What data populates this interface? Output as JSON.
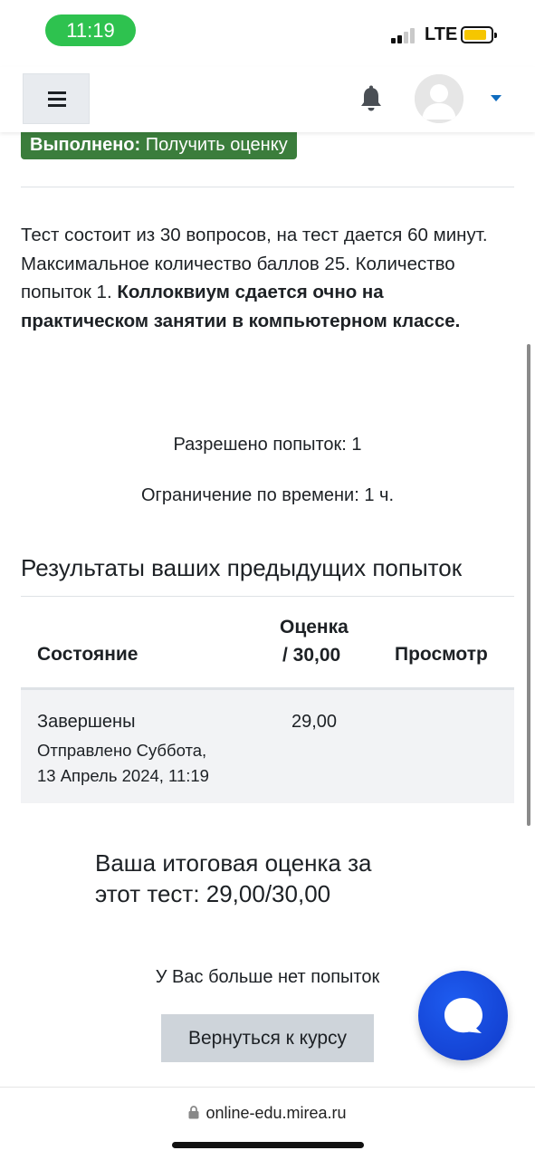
{
  "status_bar": {
    "time": "11:19",
    "network": "LTE"
  },
  "completion": {
    "label": "Выполнено:",
    "text": "Получить оценку"
  },
  "intro": {
    "plain": "Тест состоит из 30 вопросов, на тест дается 60 минут. Максимальное количество баллов 25. Количество попыток 1. ",
    "bold": "Коллоквиум сдается очно на практическом занятии в компьютерном классе."
  },
  "info": {
    "attempts_allowed": "Разрешено попыток: 1",
    "time_limit": "Ограничение по времени: 1 ч."
  },
  "results": {
    "heading": "Результаты ваших предыдущих попыток",
    "columns": {
      "state": "Состояние",
      "grade_line1": "Оценка",
      "grade_line2": "/ 30,00",
      "review": "Просмотр"
    },
    "rows": [
      {
        "state": "Завершены",
        "submitted_line1": "Отправлено Суббота,",
        "submitted_line2": "13 Апрель 2024, 11:19",
        "grade": "29,00",
        "review": ""
      }
    ]
  },
  "final_grade": {
    "line1": "Ваша итоговая оценка за",
    "line2": "этот тест: 29,00/30,00"
  },
  "no_attempts": "У Вас больше нет попыток",
  "back_button": "Вернуться к курсу",
  "browser": {
    "url": "online-edu.mirea.ru"
  },
  "colors": {
    "completion_green": "#3b7d3c",
    "accent_blue": "#0f6cbf",
    "chat_blue": "#1e4fe0",
    "status_green": "#2ec24f"
  },
  "icons": [
    "hamburger-icon",
    "bell-icon",
    "user-avatar-icon",
    "caret-down-icon",
    "chat-icon",
    "lock-icon"
  ]
}
